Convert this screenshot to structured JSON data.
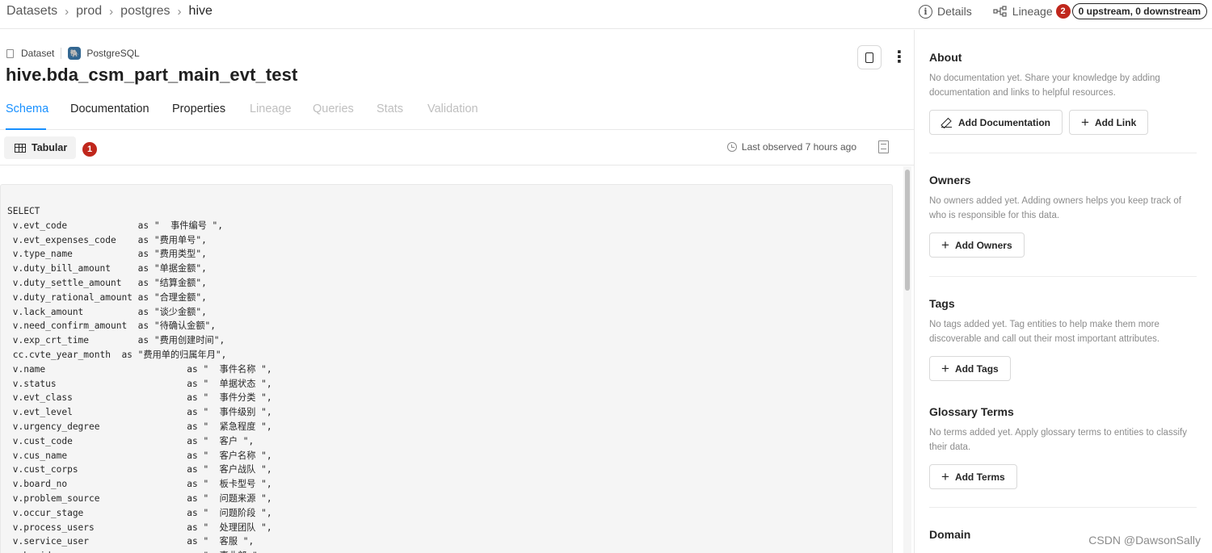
{
  "breadcrumb": [
    "Datasets",
    "prod",
    "postgres",
    "hive"
  ],
  "breadcrumb_sep": "›",
  "top_actions": {
    "details_label": "Details",
    "lineage_label": "Lineage",
    "lineage_badge": "2",
    "lineage_count": "0 upstream, 0 downstream"
  },
  "entity": {
    "type_label": "Dataset",
    "platform_label": "PostgreSQL",
    "title": "hive.bda_csm_part_main_evt_test"
  },
  "tabs": [
    {
      "label": "Schema",
      "state": "active"
    },
    {
      "label": "Documentation",
      "state": "normal"
    },
    {
      "label": "Properties",
      "state": "normal"
    },
    {
      "label": "Lineage",
      "state": "disabled"
    },
    {
      "label": "Queries",
      "state": "disabled"
    },
    {
      "label": "Stats",
      "state": "disabled"
    },
    {
      "label": "Validation",
      "state": "disabled"
    }
  ],
  "toolbar": {
    "tabular_label": "Tabular",
    "tabular_badge": "1",
    "last_observed": "Last observed 7 hours ago"
  },
  "code_lines": [
    "SELECT",
    " v.evt_code             as \"  事件编号 \",",
    " v.evt_expenses_code    as \"费用单号\",",
    " v.type_name            as \"费用类型\",",
    " v.duty_bill_amount     as \"单据金额\",",
    " v.duty_settle_amount   as \"结算金额\",",
    " v.duty_rational_amount as \"合理金额\",",
    " v.lack_amount          as \"谈少金额\",",
    " v.need_confirm_amount  as \"待确认金额\",",
    " v.exp_crt_time         as \"费用创建时间\",",
    " cc.cvte_year_month  as \"费用单的归属年月\",",
    " v.name                          as \"  事件名称 \",",
    " v.status                        as \"  单据状态 \",",
    " v.evt_class                     as \"  事件分类 \",",
    " v.evt_level                     as \"  事件级别 \",",
    " v.urgency_degree                as \"  紧急程度 \",",
    " v.cust_code                     as \"  客户 \",",
    " v.cus_name                      as \"  客户名称 \",",
    " v.cust_corps                    as \"  客户战队 \",",
    " v.board_no                      as \"  板卡型号 \",",
    " v.problem_source                as \"  问题来源 \",",
    " v.occur_stage                   as \"  问题阶段 \",",
    " v.process_users                 as \"  处理团队 \",",
    " v.service_user                  as \"  客服 \",",
    " v.bu_id                         as \"  事业部 \","
  ],
  "sidebar": {
    "about": {
      "title": "About",
      "desc": "No documentation yet. Share your knowledge by adding documentation and links to helpful resources.",
      "btn_doc": "Add Documentation",
      "btn_link": "Add Link"
    },
    "owners": {
      "title": "Owners",
      "desc": "No owners added yet. Adding owners helps you keep track of who is responsible for this data.",
      "btn": "Add Owners"
    },
    "tags": {
      "title": "Tags",
      "desc": "No tags added yet. Tag entities to help make them more discoverable and call out their most important attributes.",
      "btn": "Add Tags"
    },
    "glossary": {
      "title": "Glossary Terms",
      "desc": "No terms added yet. Apply glossary terms to entities to classify their data.",
      "btn": "Add Terms"
    },
    "domain": {
      "title": "Domain"
    }
  },
  "watermark": "CSDN @DawsonSally",
  "colors": {
    "accent": "#1890ff",
    "badge": "#c0271c",
    "postgres": "#336791"
  }
}
